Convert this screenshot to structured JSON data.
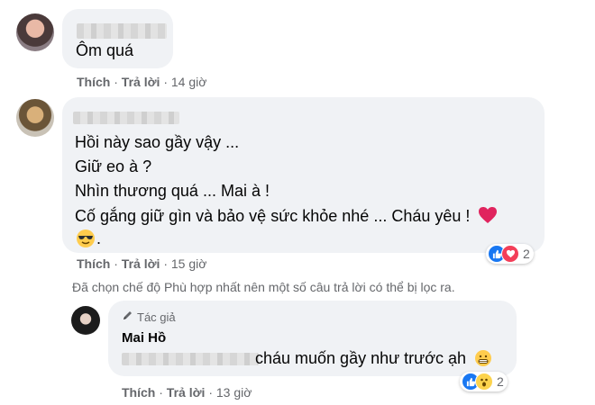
{
  "comments": [
    {
      "text": "Ôm quá",
      "actions": {
        "like": "Thích",
        "reply": "Trả lời",
        "time": "14 giờ"
      }
    },
    {
      "lines": [
        "Hồi này sao gầy vậy ...",
        "Giữ eo à ?",
        "Nhìn thương quá ... Mai à !",
        "Cố gắng giữ gìn và bảo vệ sức khỏe nhé ... Cháu yêu !"
      ],
      "actions": {
        "like": "Thích",
        "reply": "Trả lời",
        "time": "15 giờ"
      },
      "reactions": {
        "count": "2",
        "icons": [
          "like-icon",
          "love-icon"
        ]
      }
    }
  ],
  "filter_notice": "Đã chọn chế độ Phù hợp nhất nên một số câu trả lời có thể bị lọc ra.",
  "reply": {
    "author_badge": "Tác giả",
    "author_name": "Mai Hồ",
    "text": "cháu muốn gầy như trước ạh",
    "actions": {
      "like": "Thích",
      "reply": "Trả lời",
      "time": "13 giờ"
    },
    "reactions": {
      "count": "2",
      "icons": [
        "like-icon",
        "wow-icon"
      ]
    }
  },
  "colors": {
    "like": "#1877f2",
    "love": "#f33e58",
    "muted": "#65676b",
    "bubble": "#f0f2f5"
  }
}
